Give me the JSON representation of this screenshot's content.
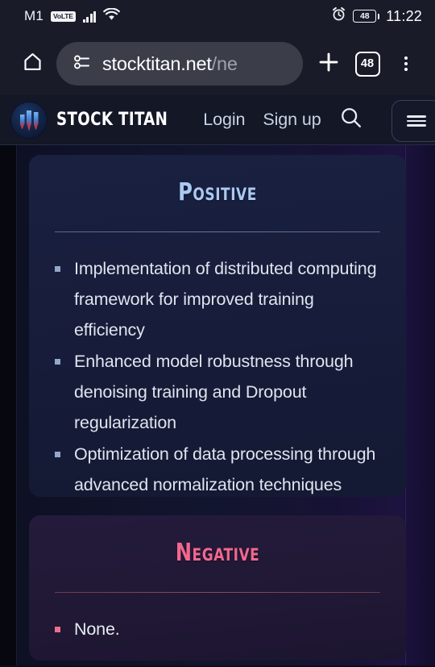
{
  "status_bar": {
    "carrier": "M1",
    "network_badge": "VoLTE",
    "signal_icon": "signal-bars-icon",
    "wifi_icon": "wifi-icon",
    "alarm_icon": "alarm-clock-icon",
    "battery_level": "48",
    "time": "11:22"
  },
  "browser": {
    "home_icon": "home-icon",
    "site_settings_icon": "tune-icon",
    "url_domain": "stocktitan.net",
    "url_path": "/ne",
    "new_tab_icon": "plus-icon",
    "tab_count": "48",
    "menu_icon": "kebab-menu-icon"
  },
  "site_header": {
    "logo_icon": "stock-titan-logo-icon",
    "brand": "STOCK TITAN",
    "login_label": "Login",
    "signup_label": "Sign up",
    "search_icon": "search-icon",
    "menu_icon": "hamburger-icon"
  },
  "cards": [
    {
      "title": "Positive",
      "accent": "#a9c9f2",
      "items": [
        "Implementation of distributed computing framework for improved training efficiency",
        "Enhanced model robustness through denoising training and Dropout regularization",
        "Optimization of data processing through advanced normalization techniques"
      ]
    },
    {
      "title": "Negative",
      "accent": "#f2678e",
      "items": [
        "None."
      ]
    }
  ]
}
